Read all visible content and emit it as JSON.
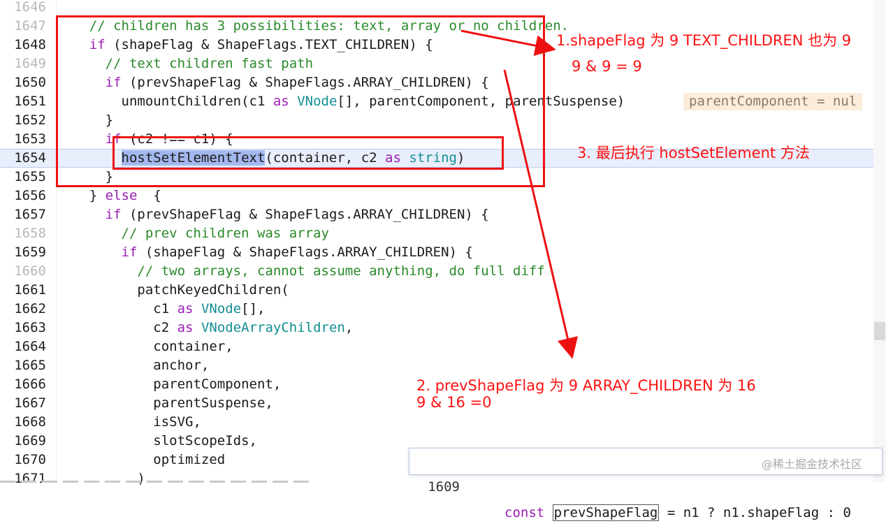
{
  "editor": {
    "lines": [
      {
        "num": "1646",
        "dim": true,
        "indent": "    ",
        "code": ""
      },
      {
        "num": "1647",
        "dim": true,
        "indent": "    ",
        "comment": "// children has 3 possibilities: text, array or no children."
      },
      {
        "num": "1648",
        "dim": false,
        "indent": "    ",
        "kw": "if",
        "code": " (shapeFlag & ShapeFlags.TEXT_CHILDREN) {"
      },
      {
        "num": "1649",
        "dim": true,
        "indent": "      ",
        "comment": "// text children fast path"
      },
      {
        "num": "1650",
        "dim": false,
        "indent": "      ",
        "kw": "if",
        "code": " (prevShapeFlag & ShapeFlags.ARRAY_CHILDREN) {"
      },
      {
        "num": "1651",
        "dim": false,
        "indent": "        ",
        "code": "unmountChildren(c1 ",
        "kw2": "as",
        "ty": "VNode",
        "code2": "[], parentComponent, parentSuspense)"
      },
      {
        "num": "1652",
        "dim": false,
        "indent": "      ",
        "code": "}"
      },
      {
        "num": "1653",
        "dim": false,
        "indent": "      ",
        "kw": "if",
        "code": " (c2 !== c1) {"
      },
      {
        "num": "1654",
        "dim": false,
        "indent": "        ",
        "sel": "hostSetElementText",
        "code": "(container, c2 ",
        "kw2": "as",
        "ty": "string",
        "code2": ")"
      },
      {
        "num": "1655",
        "dim": false,
        "indent": "      ",
        "code": "}"
      },
      {
        "num": "1656",
        "dim": false,
        "indent": "    ",
        "code": "} ",
        "kw2": "else",
        "code2": " {"
      },
      {
        "num": "1657",
        "dim": false,
        "indent": "      ",
        "kw": "if",
        "code": " (prevShapeFlag & ShapeFlags.ARRAY_CHILDREN) {"
      },
      {
        "num": "1658",
        "dim": true,
        "indent": "        ",
        "comment": "// prev children was array"
      },
      {
        "num": "1659",
        "dim": false,
        "indent": "        ",
        "kw": "if",
        "code": " (shapeFlag & ShapeFlags.ARRAY_CHILDREN) {"
      },
      {
        "num": "1660",
        "dim": true,
        "indent": "          ",
        "comment": "// two arrays, cannot assume anything, do full diff"
      },
      {
        "num": "1661",
        "dim": false,
        "indent": "          ",
        "code": "patchKeyedChildren("
      },
      {
        "num": "1662",
        "dim": false,
        "indent": "            ",
        "code": "c1 ",
        "kw2": "as",
        "ty": "VNode",
        "code2": "[],"
      },
      {
        "num": "1663",
        "dim": false,
        "indent": "            ",
        "code": "c2 ",
        "kw2": "as",
        "ty": "VNodeArrayChildren",
        "code2": ","
      },
      {
        "num": "1664",
        "dim": false,
        "indent": "            ",
        "code": "container,"
      },
      {
        "num": "1665",
        "dim": false,
        "indent": "            ",
        "code": "anchor,"
      },
      {
        "num": "1666",
        "dim": false,
        "indent": "            ",
        "code": "parentComponent,"
      },
      {
        "num": "1667",
        "dim": false,
        "indent": "            ",
        "code": "parentSuspense,"
      },
      {
        "num": "1668",
        "dim": false,
        "indent": "            ",
        "code": "isSVG,"
      },
      {
        "num": "1669",
        "dim": false,
        "indent": "            ",
        "code": "slotScopeIds,"
      },
      {
        "num": "1670",
        "dim": false,
        "indent": "            ",
        "code": "optimized"
      },
      {
        "num": "1671",
        "dim": false,
        "indent": "          ",
        "code": ")"
      }
    ],
    "inlay_hint": "parentComponent = nul",
    "current_line": "1654"
  },
  "annotations": {
    "a1": "1.shapeFlag 为 9   TEXT_CHILDREN 也为 9",
    "a1b": "9 & 9 = 9",
    "a2": "2. prevShapeFlag 为 9  ARRAY_CHILDREN 为 16",
    "a2b": "9 & 16 =0",
    "a3": "3. 最后执行 hostSetElement 方法"
  },
  "popup": {
    "line_num": "1609",
    "kw": "const",
    "boxed": "prevShapeFlag",
    "rest": " = n1 ? n1.shapeFlag : 0"
  },
  "watermark": "@稀土掘金技术社区",
  "colors": {
    "annotation": "#ff1010",
    "keyword": "#9a1db5",
    "comment": "#2a8a2a",
    "type": "#138f94"
  }
}
